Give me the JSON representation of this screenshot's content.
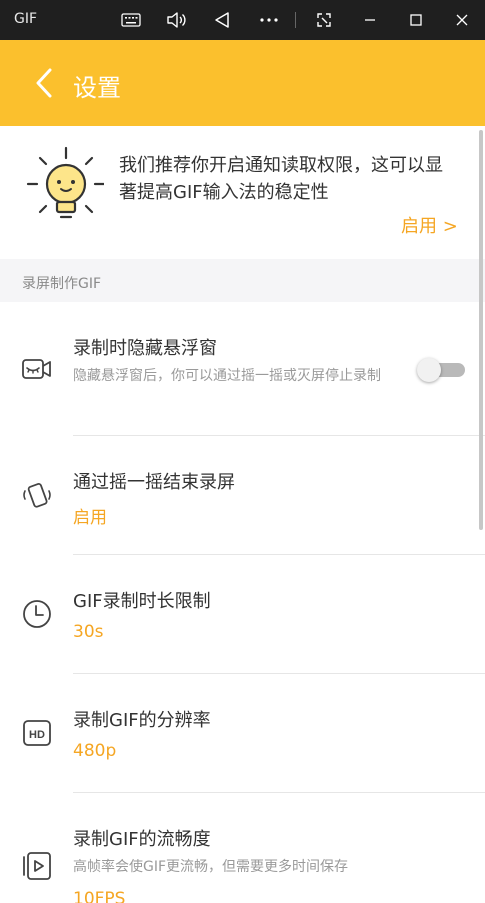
{
  "window": {
    "app_title": "GIF",
    "buttons": [
      {
        "name": "keyboard-icon"
      },
      {
        "name": "volume-icon"
      },
      {
        "name": "back-triangle-icon"
      },
      {
        "name": "more-icon"
      },
      {
        "name": "screenshot-icon"
      },
      {
        "name": "minimize-icon"
      },
      {
        "name": "maximize-icon"
      },
      {
        "name": "close-icon"
      }
    ]
  },
  "header": {
    "title": "设置",
    "background": "#fbc02d"
  },
  "notice": {
    "text": "我们推荐你开启通知读取权限，这可以显著提高GIF输入法的稳定性",
    "action_label": "启用 >",
    "icon": "lightbulb-icon"
  },
  "section": {
    "label": "录屏制作GIF"
  },
  "settings": [
    {
      "icon": "video-hidden-icon",
      "title": "录制时隐藏悬浮窗",
      "description": "隐藏悬浮窗后，你可以通过摇一摇或灭屏停止录制",
      "toggle_on": false
    },
    {
      "icon": "shake-phone-icon",
      "title": "通过摇一摇结束录屏",
      "value": "启用"
    },
    {
      "icon": "clock-icon",
      "title": "GIF录制时长限制",
      "value": "30s"
    },
    {
      "icon": "hd-icon",
      "title": "录制GIF的分辨率",
      "value": "480p"
    },
    {
      "icon": "play-frames-icon",
      "title": "录制GIF的流畅度",
      "description": "高帧率会使GIF更流畅，但需要更多时间保存",
      "value": "10FPS"
    }
  ],
  "colors": {
    "accent": "#f5a623",
    "title_bar": "#1f1f1f"
  }
}
